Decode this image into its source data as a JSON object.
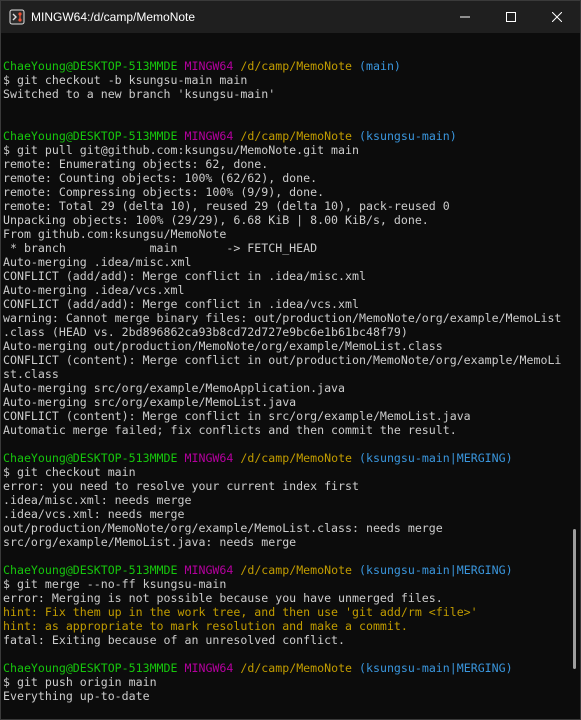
{
  "window": {
    "title": "MINGW64:/d/camp/MemoNote",
    "icon": "git-bash-icon",
    "controls": {
      "minimize": "minimize-icon",
      "maximize": "maximize-icon",
      "close": "close-icon"
    }
  },
  "colors": {
    "background": "#0c0c0c",
    "text": "#cccccc",
    "user": "#16c60c",
    "system": "#b4009e",
    "path": "#c19c00",
    "branch": "#3a96dd",
    "hint": "#c19c00"
  },
  "terminal": {
    "lines": [
      {
        "type": "blank"
      },
      {
        "type": "prompt",
        "user": "ChaeYoung@DESKTOP-513MMDE",
        "system": "MINGW64",
        "path": "/d/camp/MemoNote",
        "branch": "(main)"
      },
      {
        "type": "text",
        "text": "$ git checkout -b ksungsu-main main"
      },
      {
        "type": "text",
        "text": "Switched to a new branch 'ksungsu-main'"
      },
      {
        "type": "blank"
      },
      {
        "type": "blank"
      },
      {
        "type": "prompt",
        "user": "ChaeYoung@DESKTOP-513MMDE",
        "system": "MINGW64",
        "path": "/d/camp/MemoNote",
        "branch": "(ksungsu-main)"
      },
      {
        "type": "text",
        "text": "$ git pull git@github.com:ksungsu/MemoNote.git main"
      },
      {
        "type": "text",
        "text": "remote: Enumerating objects: 62, done."
      },
      {
        "type": "text",
        "text": "remote: Counting objects: 100% (62/62), done."
      },
      {
        "type": "text",
        "text": "remote: Compressing objects: 100% (9/9), done."
      },
      {
        "type": "text",
        "text": "remote: Total 29 (delta 10), reused 29 (delta 10), pack-reused 0"
      },
      {
        "type": "text",
        "text": "Unpacking objects: 100% (29/29), 6.68 KiB | 8.00 KiB/s, done."
      },
      {
        "type": "text",
        "text": "From github.com:ksungsu/MemoNote"
      },
      {
        "type": "text",
        "text": " * branch            main       -> FETCH_HEAD"
      },
      {
        "type": "text",
        "text": "Auto-merging .idea/misc.xml"
      },
      {
        "type": "text",
        "text": "CONFLICT (add/add): Merge conflict in .idea/misc.xml"
      },
      {
        "type": "text",
        "text": "Auto-merging .idea/vcs.xml"
      },
      {
        "type": "text",
        "text": "CONFLICT (add/add): Merge conflict in .idea/vcs.xml"
      },
      {
        "type": "text",
        "text": "warning: Cannot merge binary files: out/production/MemoNote/org/example/MemoList"
      },
      {
        "type": "text",
        "text": ".class (HEAD vs. 2bd896862ca93b8cd72d727e9bc6e1b61bc48f79)"
      },
      {
        "type": "text",
        "text": "Auto-merging out/production/MemoNote/org/example/MemoList.class"
      },
      {
        "type": "text",
        "text": "CONFLICT (content): Merge conflict in out/production/MemoNote/org/example/MemoLi"
      },
      {
        "type": "text",
        "text": "st.class"
      },
      {
        "type": "text",
        "text": "Auto-merging src/org/example/MemoApplication.java"
      },
      {
        "type": "text",
        "text": "Auto-merging src/org/example/MemoList.java"
      },
      {
        "type": "text",
        "text": "CONFLICT (content): Merge conflict in src/org/example/MemoList.java"
      },
      {
        "type": "text",
        "text": "Automatic merge failed; fix conflicts and then commit the result."
      },
      {
        "type": "blank"
      },
      {
        "type": "prompt",
        "user": "ChaeYoung@DESKTOP-513MMDE",
        "system": "MINGW64",
        "path": "/d/camp/MemoNote",
        "branch": "(ksungsu-main|MERGING)"
      },
      {
        "type": "text",
        "text": "$ git checkout main"
      },
      {
        "type": "text",
        "text": "error: you need to resolve your current index first"
      },
      {
        "type": "text",
        "text": ".idea/misc.xml: needs merge"
      },
      {
        "type": "text",
        "text": ".idea/vcs.xml: needs merge"
      },
      {
        "type": "text",
        "text": "out/production/MemoNote/org/example/MemoList.class: needs merge"
      },
      {
        "type": "text",
        "text": "src/org/example/MemoList.java: needs merge"
      },
      {
        "type": "blank"
      },
      {
        "type": "prompt",
        "user": "ChaeYoung@DESKTOP-513MMDE",
        "system": "MINGW64",
        "path": "/d/camp/MemoNote",
        "branch": "(ksungsu-main|MERGING)"
      },
      {
        "type": "text",
        "text": "$ git merge --no-ff ksungsu-main"
      },
      {
        "type": "text",
        "text": "error: Merging is not possible because you have unmerged files."
      },
      {
        "type": "hint",
        "text": "hint: Fix them up in the work tree, and then use 'git add/rm <file>'"
      },
      {
        "type": "hint",
        "text": "hint: as appropriate to mark resolution and make a commit."
      },
      {
        "type": "text",
        "text": "fatal: Exiting because of an unresolved conflict."
      },
      {
        "type": "blank"
      },
      {
        "type": "prompt",
        "user": "ChaeYoung@DESKTOP-513MMDE",
        "system": "MINGW64",
        "path": "/d/camp/MemoNote",
        "branch": "(ksungsu-main|MERGING)"
      },
      {
        "type": "text",
        "text": "$ git push origin main"
      },
      {
        "type": "text",
        "text": "Everything up-to-date"
      },
      {
        "type": "blank"
      },
      {
        "type": "prompt",
        "user": "ChaeYoung@DESKTOP-513MMDE",
        "system": "MINGW64",
        "path": "/d/camp/MemoNote",
        "branch": "(ksungsu-main|MERGING)"
      },
      {
        "type": "input",
        "text": "$ "
      }
    ]
  }
}
